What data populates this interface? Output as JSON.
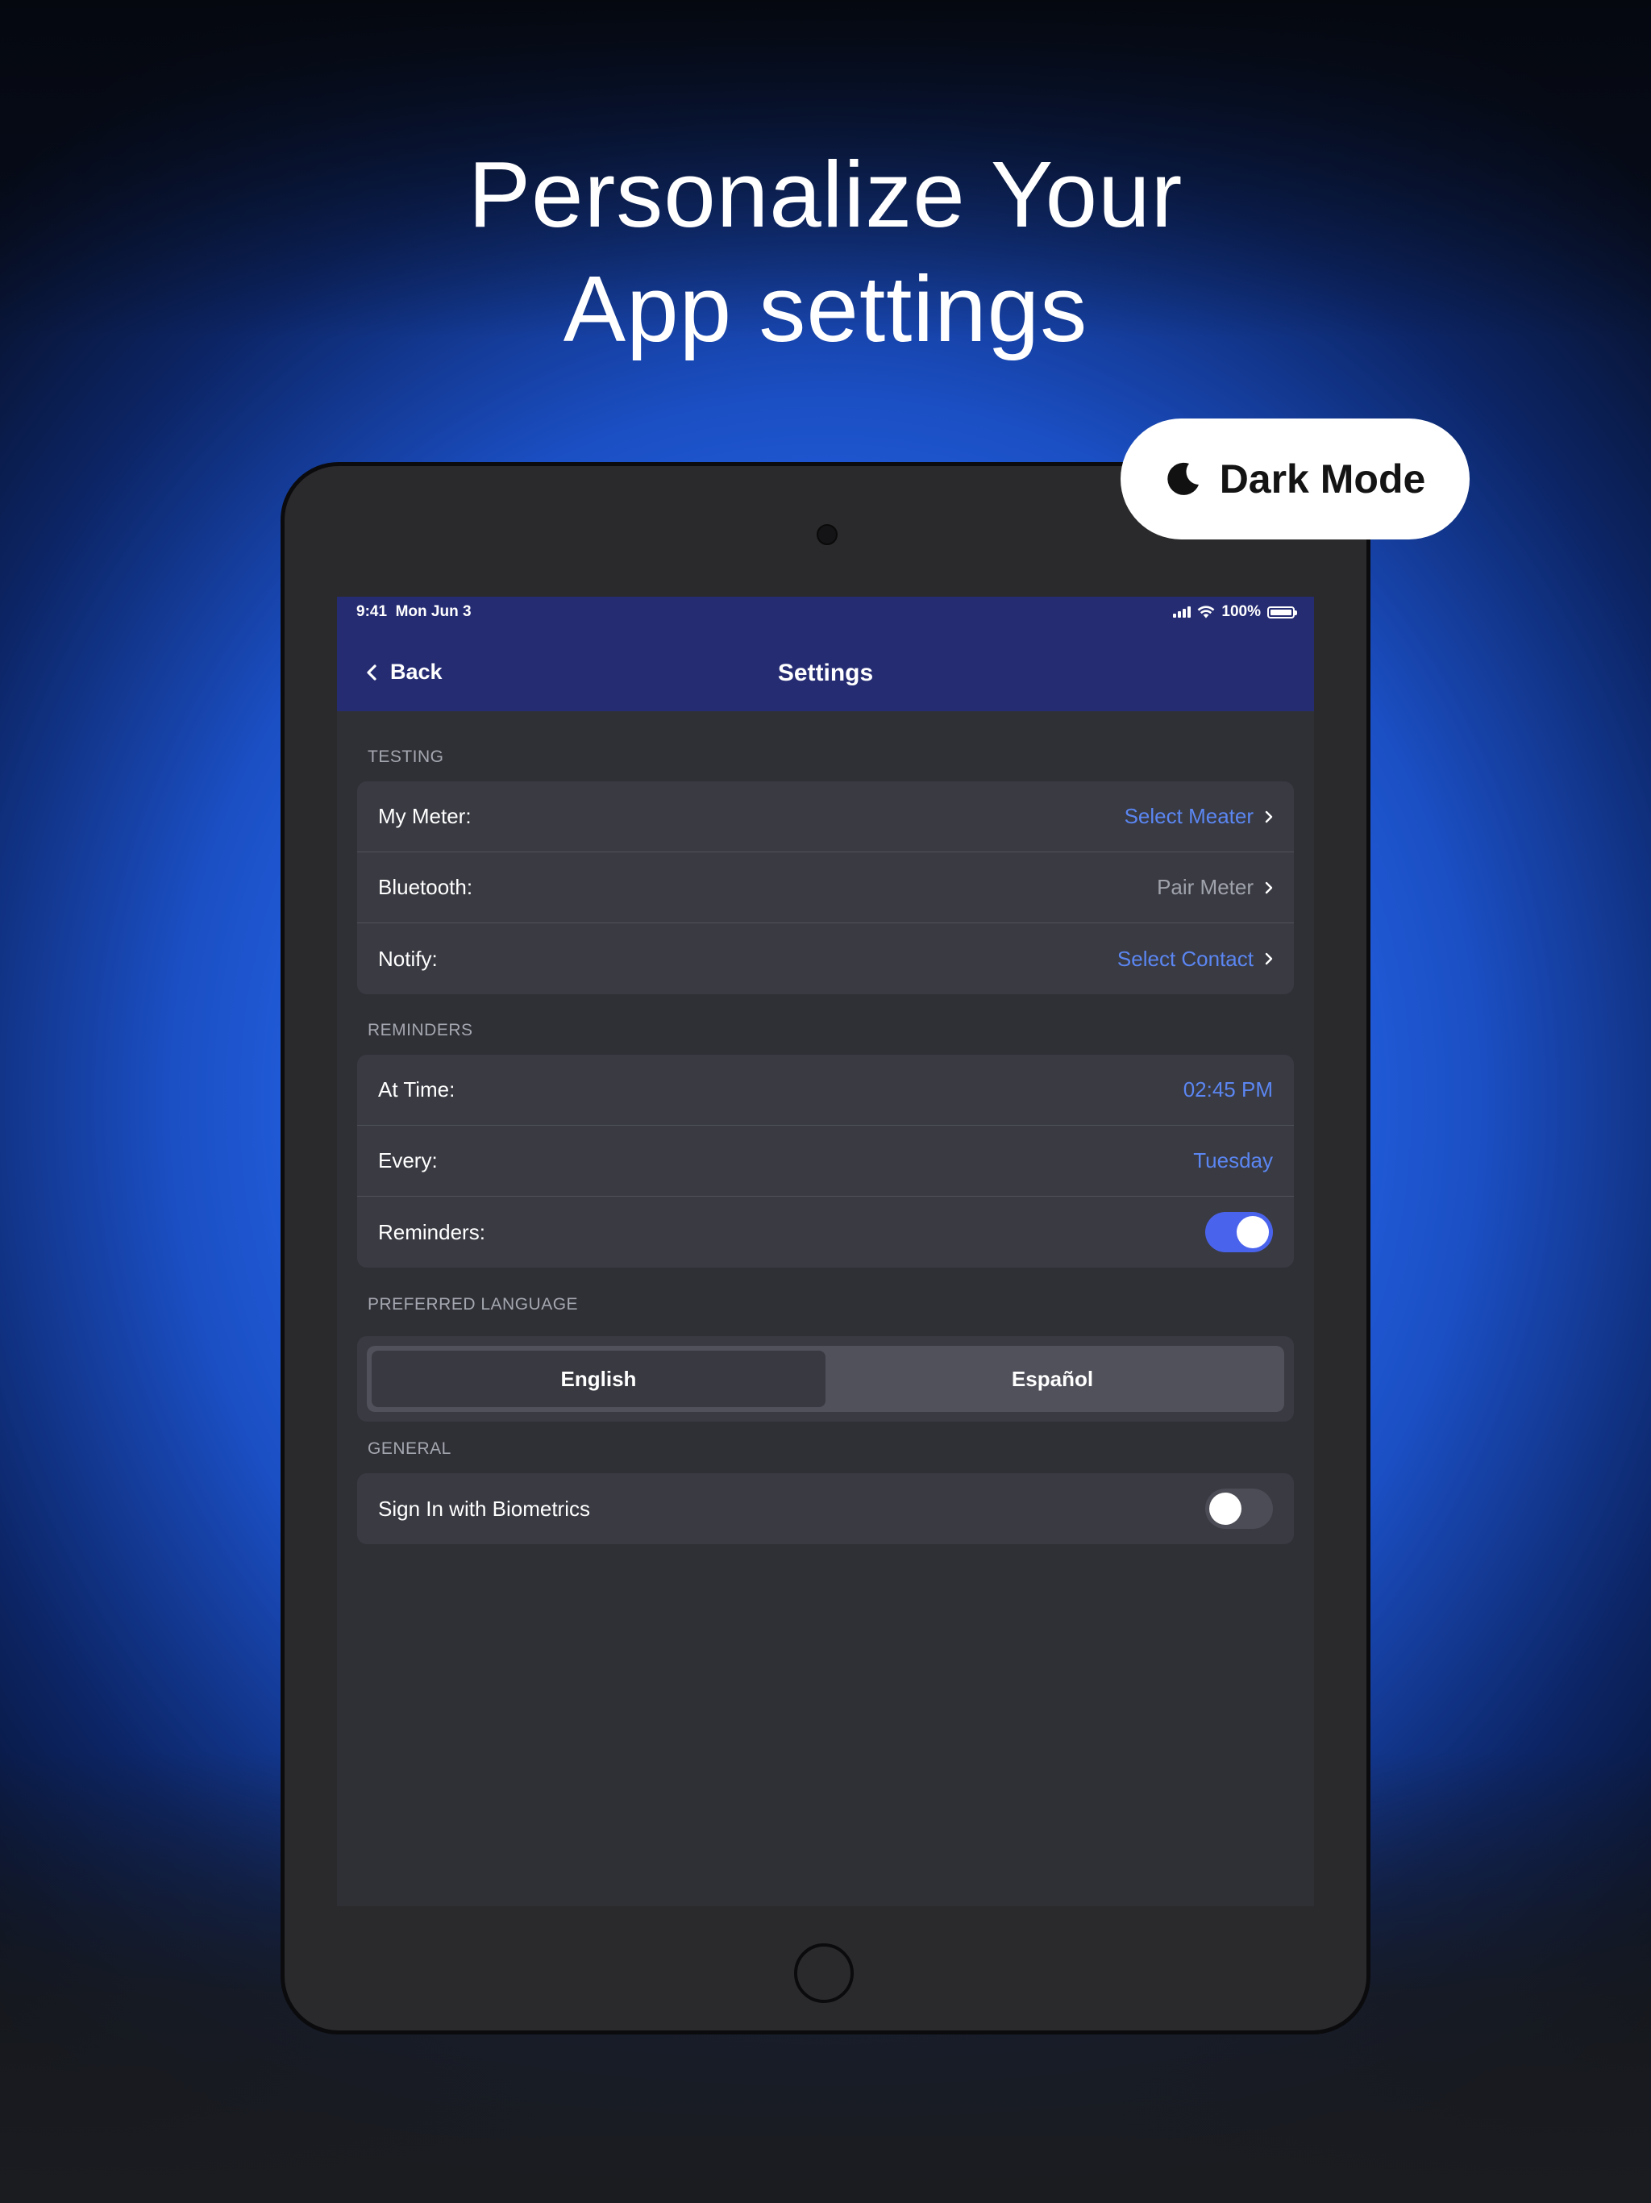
{
  "headline": {
    "line1": "Personalize Your",
    "line2": "App settings"
  },
  "badge": {
    "label": "Dark Mode",
    "icon": "moon-icon"
  },
  "status_bar": {
    "time": "9:41",
    "date": "Mon Jun 3",
    "battery": "100%"
  },
  "nav": {
    "back_label": "Back",
    "title": "Settings"
  },
  "sections": {
    "testing": {
      "label": "TESTING",
      "rows": [
        {
          "label": "My Meter:",
          "value": "Select Meater",
          "value_color": "#5b86f2"
        },
        {
          "label": "Bluetooth:",
          "value": "Pair Meter",
          "value_color": "#a0a2ab"
        },
        {
          "label": "Notify:",
          "value": "Select Contact",
          "value_color": "#5b86f2"
        }
      ]
    },
    "reminders": {
      "label": "REMINDERS",
      "rows": [
        {
          "label": "At Time:",
          "value": "02:45 PM"
        },
        {
          "label": "Every:",
          "value": "Tuesday"
        },
        {
          "label": "Reminders:",
          "toggle": true
        }
      ]
    },
    "language": {
      "label": "PREFERRED LANGUAGE",
      "options": [
        "English",
        "Español"
      ],
      "selected": "English"
    },
    "general": {
      "label": "GENERAL",
      "rows": [
        {
          "label": "Sign In with Biometrics",
          "toggle": false
        }
      ]
    }
  },
  "colors": {
    "accent": "#4a63ec",
    "link": "#5b86f2",
    "nav_bar": "#252c72",
    "screen_bg": "#2f3036",
    "card_bg": "#393a42"
  }
}
